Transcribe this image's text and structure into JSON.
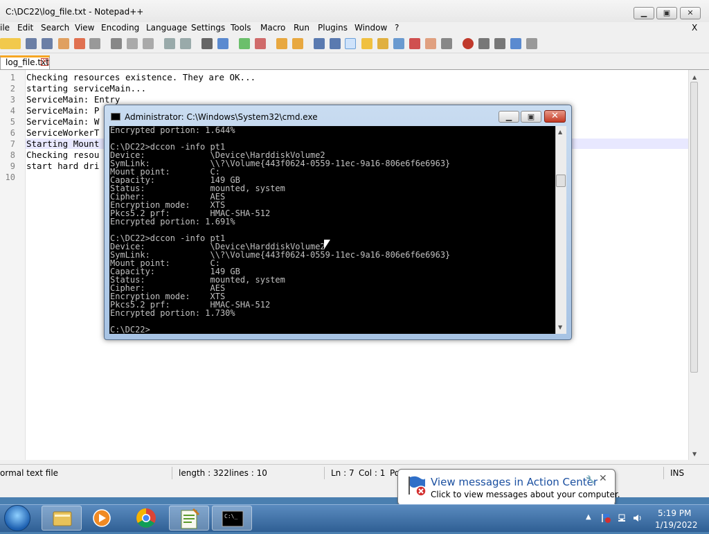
{
  "npp": {
    "title": "C:\\DC22\\log_file.txt - Notepad++",
    "menu": [
      "ile",
      "Edit",
      "Search",
      "View",
      "Encoding",
      "Language",
      "Settings",
      "Tools",
      "Macro",
      "Run",
      "Plugins",
      "Window",
      "?"
    ],
    "menu_close": "X",
    "tab_label": "log_file.txt",
    "line_numbers": [
      "1",
      "2",
      "3",
      "4",
      "5",
      "6",
      "7",
      "8",
      "9",
      "10"
    ],
    "lines": [
      "Checking resources existence. They are OK...",
      "starting serviceMain...",
      "ServiceMain: Entry",
      "ServiceMain: P",
      "ServiceMain: W",
      "ServiceWorkerT",
      "Starting Mount",
      "Checking resou",
      "start hard dri",
      ""
    ],
    "status": {
      "file_type": "ormal text file",
      "length": "length : 322",
      "lines": "lines : 10",
      "ln": "Ln : 7",
      "col": "Col : 1",
      "pos": "Po",
      "mode": "INS"
    }
  },
  "cmd": {
    "title": "Administrator: C:\\Windows\\System32\\cmd.exe",
    "icon_text": "C:\\",
    "output": "Encrypted portion: 1.644%\n\nC:\\DC22>dccon -info pt1\nDevice:             \\Device\\HarddiskVolume2\nSymLink:            \\\\?\\Volume{443f0624-0559-11ec-9a16-806e6f6e6963}\nMount point:        C:\nCapacity:           149 GB\nStatus:             mounted, system\nCipher:             AES\nEncryption mode:    XTS\nPkcs5.2 prf:        HMAC-SHA-512\nEncrypted portion: 1.691%\n\nC:\\DC22>dccon -info pt1\nDevice:             \\Device\\HarddiskVolume2\nSymLink:            \\\\?\\Volume{443f0624-0559-11ec-9a16-806e6f6e6963}\nMount point:        C:\nCapacity:           149 GB\nStatus:             mounted, system\nCipher:             AES\nEncryption mode:    XTS\nPkcs5.2 prf:        HMAC-SHA-512\nEncrypted portion: 1.730%\n\nC:\\DC22>"
  },
  "balloon": {
    "title": "View messages in Action Center",
    "message": "Click to view messages about your computer."
  },
  "taskbar": {
    "time": "5:19 PM",
    "date": "1/19/2022",
    "cmd_icon_text": "C:\\_"
  },
  "icons": [
    "start-orb",
    "explorer-icon",
    "media-player-icon",
    "chrome-icon",
    "notepadpp-icon",
    "cmd-icon",
    "action-center-flag-icon",
    "network-icon",
    "volume-icon"
  ],
  "colors": {
    "tab_accent": "#f6a623",
    "balloon_title": "#1a4fa0",
    "taskbar": "#2f5f94",
    "cmd_close": "#c43a24"
  }
}
